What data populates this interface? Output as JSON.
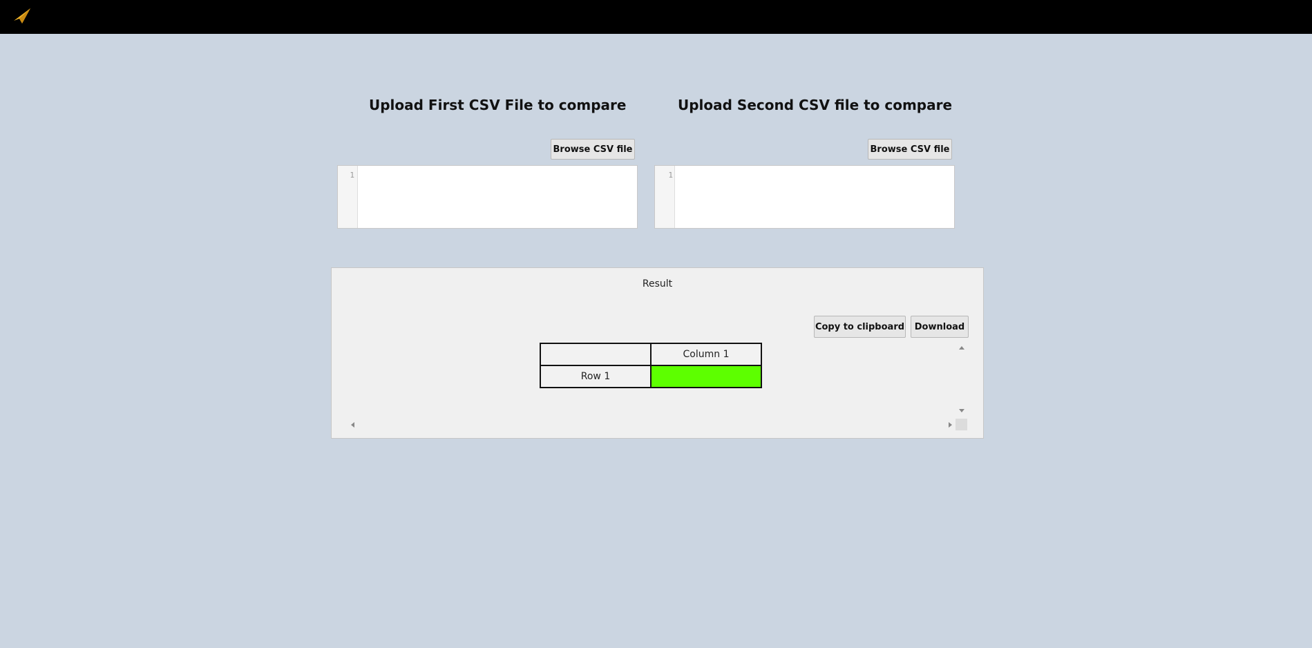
{
  "app": {
    "logo_icon": "paper-plane-icon",
    "logo_color": "#f0b429"
  },
  "left_panel": {
    "title": "Upload First CSV File to compare",
    "browse_label": "Browse CSV file",
    "line_number": "1",
    "content": ""
  },
  "right_panel": {
    "title": "Upload Second CSV file to compare",
    "browse_label": "Browse CSV file",
    "line_number": "1",
    "content": ""
  },
  "result": {
    "title": "Result",
    "copy_label": "Copy to clipboard",
    "download_label": "Download",
    "table": {
      "corner": "",
      "column_headers": [
        "Column 1"
      ],
      "rows": [
        {
          "header": "Row 1",
          "cells": [
            ""
          ]
        }
      ],
      "highlight_color": "#5dff00"
    }
  }
}
